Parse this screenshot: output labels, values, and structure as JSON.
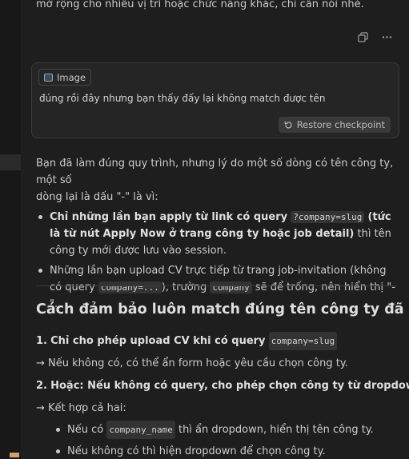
{
  "top_line": "mở rộng cho nhiều vị trí hoặc chức năng khác, chỉ cần nói nhé.",
  "actions": {
    "copy_icon": "copy-icon",
    "more_icon": "more-icon"
  },
  "user_message": {
    "attachment_label": "Image",
    "text": "đúng rồi đây nhưng bạn thấy đấy lại không match được tên",
    "restore_label": "Restore checkpoint"
  },
  "reply": {
    "intro_line1": "Bạn đã làm đúng quy trình, nhưng lý do một số dòng có tên công ty, một số",
    "intro_line2": "dòng lại là dấu \"-\" là vì:",
    "bullet1": {
      "bold_part": "Chỉ những lần bạn apply từ link có query",
      "code": "?company=slug",
      "bold_rest": "(tức là từ nút",
      "bold_line2": "Apply Now ở trang công ty hoặc job detail)",
      "plain_line2": "thì tên công ty mới được lưu",
      "plain_line3": "vào session."
    },
    "bullet2": {
      "text1": "Những lần bạn upload CV trực tiếp từ trang job-invitation (không có query",
      "code1": "company=...",
      "text2": "), trường",
      "code2": "company",
      "text3": "sẽ để trống, nên hiển thị \"-\"."
    }
  },
  "heading": "Cách đảm bảo luôn match đúng tên công ty đã apply:",
  "steps": {
    "step1_num": "1.",
    "step1_bold": "Chỉ cho phép upload CV khi có query",
    "step1_code": "company=slug",
    "step1_note": "→ Nếu không có, có thể ẩn form hoặc yêu cầu chọn công ty.",
    "step2_num": "2.",
    "step2_bold": "Hoặc: Nếu không có query, cho phép chọn công ty từ dropdown",
    "combine": "→ Kết hợp cả hai:",
    "sub1_pre": "Nếu có",
    "sub1_code": "company_name",
    "sub1_post": "thì ẩn dropdown, hiển thị tên công ty.",
    "sub2": "Nếu không có thì hiện dropdown để chọn công ty."
  }
}
